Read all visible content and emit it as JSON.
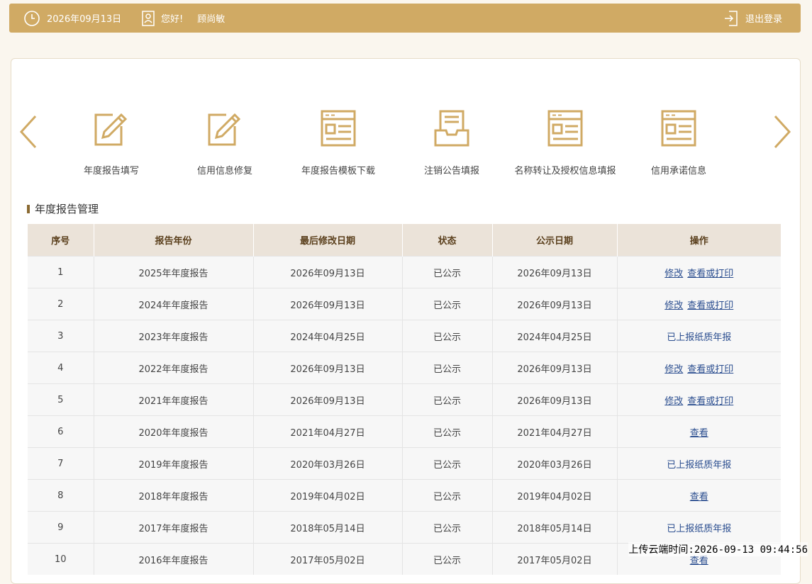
{
  "header": {
    "date": "2026年09月13日",
    "greeting": "您好!",
    "username": "顾尚敏",
    "logout_label": "退出登录"
  },
  "carousel": {
    "items": [
      {
        "label": "年度报告填写",
        "icon": "edit-document-icon"
      },
      {
        "label": "信用信息修复",
        "icon": "edit-document-icon"
      },
      {
        "label": "年度报告模板下载",
        "icon": "template-window-icon"
      },
      {
        "label": "注销公告填报",
        "icon": "inbox-tray-icon"
      },
      {
        "label": "名称转让及授权信息填报",
        "icon": "template-window-icon"
      },
      {
        "label": "信用承诺信息",
        "icon": "template-window-icon"
      }
    ]
  },
  "section": {
    "title": "年度报告管理"
  },
  "table": {
    "headers": [
      "序号",
      "报告年份",
      "最后修改日期",
      "状态",
      "公示日期",
      "操作"
    ],
    "rows": [
      {
        "no": "1",
        "year": "2025年年度报告",
        "modified": "2026年09月13日",
        "status": "已公示",
        "published": "2026年09月13日",
        "ops": [
          {
            "text": "修改",
            "link": true
          },
          {
            "text": "查看或打印",
            "link": true
          }
        ]
      },
      {
        "no": "2",
        "year": "2024年年度报告",
        "modified": "2026年09月13日",
        "status": "已公示",
        "published": "2026年09月13日",
        "ops": [
          {
            "text": "修改",
            "link": true
          },
          {
            "text": "查看或打印",
            "link": true
          }
        ]
      },
      {
        "no": "3",
        "year": "2023年年度报告",
        "modified": "2024年04月25日",
        "status": "已公示",
        "published": "2024年04月25日",
        "ops": [
          {
            "text": "已上报纸质年报",
            "link": false
          }
        ]
      },
      {
        "no": "4",
        "year": "2022年年度报告",
        "modified": "2026年09月13日",
        "status": "已公示",
        "published": "2026年09月13日",
        "ops": [
          {
            "text": "修改",
            "link": true
          },
          {
            "text": "查看或打印",
            "link": true
          }
        ]
      },
      {
        "no": "5",
        "year": "2021年年度报告",
        "modified": "2026年09月13日",
        "status": "已公示",
        "published": "2026年09月13日",
        "ops": [
          {
            "text": "修改",
            "link": true
          },
          {
            "text": "查看或打印",
            "link": true
          }
        ]
      },
      {
        "no": "6",
        "year": "2020年年度报告",
        "modified": "2021年04月27日",
        "status": "已公示",
        "published": "2021年04月27日",
        "ops": [
          {
            "text": "查看",
            "link": true
          }
        ]
      },
      {
        "no": "7",
        "year": "2019年年度报告",
        "modified": "2020年03月26日",
        "status": "已公示",
        "published": "2020年03月26日",
        "ops": [
          {
            "text": "已上报纸质年报",
            "link": false
          }
        ]
      },
      {
        "no": "8",
        "year": "2018年年度报告",
        "modified": "2019年04月02日",
        "status": "已公示",
        "published": "2019年04月02日",
        "ops": [
          {
            "text": "查看",
            "link": true
          }
        ]
      },
      {
        "no": "9",
        "year": "2017年年度报告",
        "modified": "2018年05月14日",
        "status": "已公示",
        "published": "2018年05月14日",
        "ops": [
          {
            "text": "已上报纸质年报",
            "link": false
          }
        ]
      },
      {
        "no": "10",
        "year": "2016年年度报告",
        "modified": "2017年05月02日",
        "status": "已公示",
        "published": "2017年05月02日",
        "ops": [
          {
            "text": "查看",
            "link": true
          }
        ]
      }
    ]
  },
  "watermark": "上传云端时间:2026-09-13 09:44:56",
  "colors": {
    "gold": "#d0aa64",
    "header_bg": "#ebe3d9",
    "link": "#2a4d8f",
    "page_bg": "#faf6ee"
  }
}
